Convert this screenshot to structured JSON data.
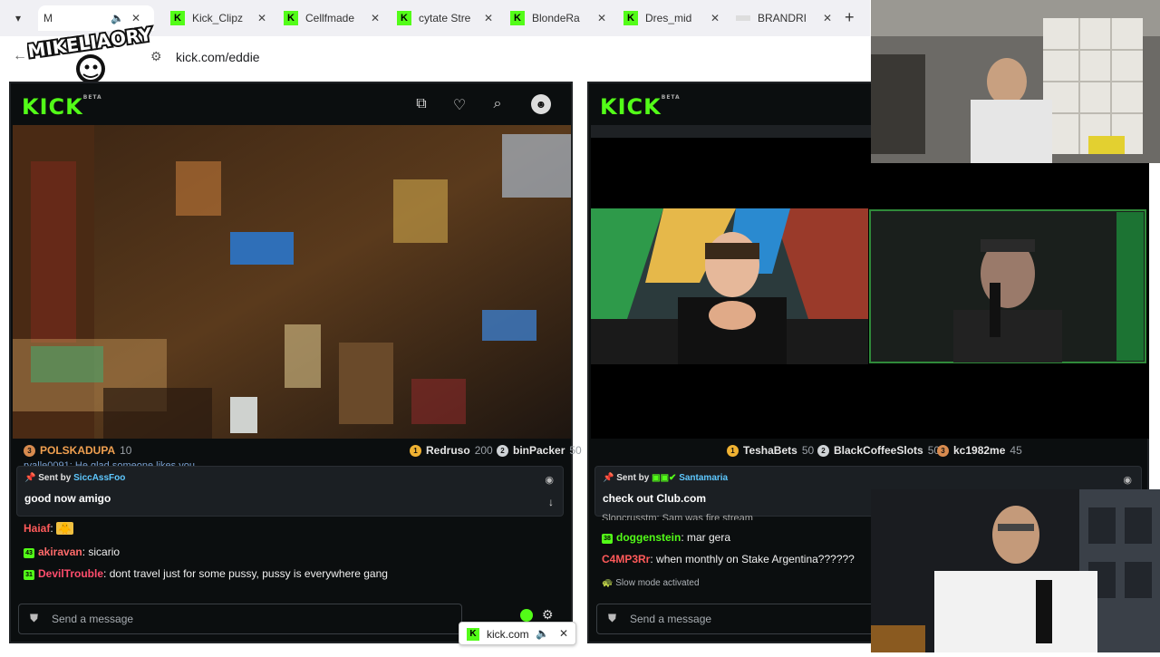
{
  "browser": {
    "tabs": [
      {
        "title": "M",
        "active": true
      },
      {
        "title": "Kick_Clipz"
      },
      {
        "title": "Cellfmade"
      },
      {
        "title": "cytate Stre"
      },
      {
        "title": "BlondeRa"
      },
      {
        "title": "Dres_mid"
      },
      {
        "title": "BRANDRI"
      }
    ],
    "url": "kick.com/eddie",
    "logo_text": "MIKELIAORY"
  },
  "left_panel": {
    "brand": "KICK",
    "leaderboard": [
      {
        "rank": "3",
        "name": "POLSKADUPA",
        "points": "10"
      },
      {
        "rank": "1",
        "name": "Redruso",
        "points": "200"
      },
      {
        "rank": "2",
        "name": "binPacker",
        "points": "50"
      }
    ],
    "cut_message": "ryalle0091: He glad someone likes you",
    "pinned": {
      "sent_by_label": "Sent by",
      "sender": "SiccAssFoo",
      "message": "good now amigo"
    },
    "chat": [
      {
        "user": "Haiaf",
        "color": "#ff5a5a",
        "text": ":",
        "emoji": "🐥"
      },
      {
        "user": "akiravan",
        "color": "#ff6b6b",
        "badge": "43",
        "text": ": sicario"
      },
      {
        "user": "DevilTrouble",
        "color": "#ff4d6d",
        "badge": "31",
        "text": ": dont travel just for some pussy, pussy is everywhere gang"
      }
    ],
    "input_placeholder": "Send a message"
  },
  "right_panel": {
    "brand": "KICK",
    "leaderboard": [
      {
        "rank": "1",
        "name": "TeshaBets",
        "points": "50"
      },
      {
        "rank": "2",
        "name": "BlackCoffeeSlots",
        "points": "50"
      },
      {
        "rank": "3",
        "name": "kc1982me",
        "points": "45"
      }
    ],
    "pinned": {
      "sent_by_label": "Sent by",
      "sender": "Santamaria",
      "message": "check out Club.com"
    },
    "cut_message": "Sloncrusstm: Sam was fire stream",
    "chat": [
      {
        "user": "doggenstein",
        "color": "#53fc18",
        "badge": "38",
        "text": ": mar gera"
      },
      {
        "user": "C4MP3Rr",
        "color": "#ff5a5a",
        "text": ": when monthly on Stake Argentina??????"
      }
    ],
    "slow_mode": "Slow mode activated",
    "input_placeholder": "Send a message"
  },
  "share_popup": {
    "site": "kick.com"
  },
  "colors": {
    "kick_green": "#53fc18",
    "panel_bg": "#0b0e0f"
  }
}
